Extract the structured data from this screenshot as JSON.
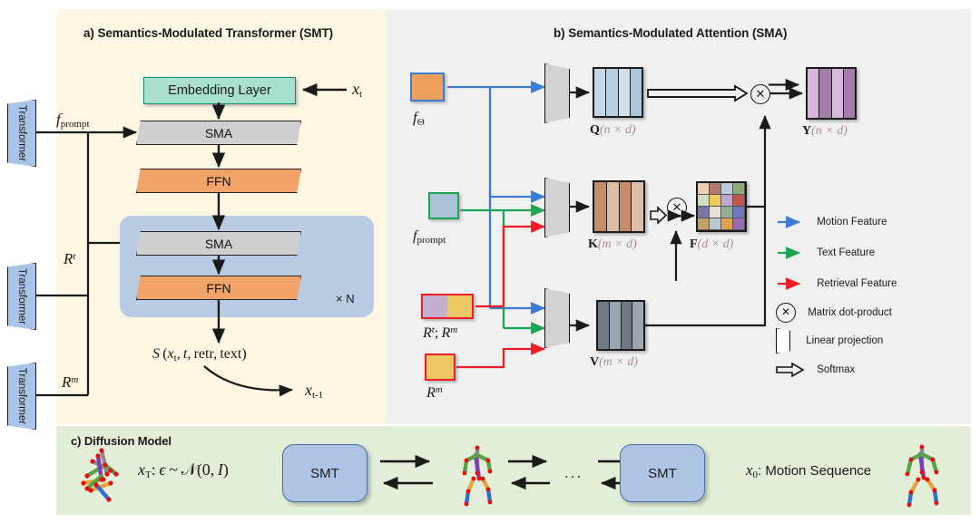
{
  "panels": {
    "a": {
      "title": "a) Semantics-Modulated Transformer (SMT)"
    },
    "b": {
      "title": "b) Semantics-Modulated Attention (SMA)"
    },
    "c": {
      "title": "c) Diffusion Model"
    }
  },
  "smt": {
    "embedding_label": "Embedding Layer",
    "input_token": "xₜ",
    "sma_label": "SMA",
    "ffn_label": "FFN",
    "repeat_label": "× N",
    "output_expr": "S(xₜ, t, retr, text)",
    "output_token": "xₜ₋₁",
    "transformers": [
      {
        "label": "Transformer",
        "output": "f_prompt"
      },
      {
        "label": "Transformer",
        "output": "R^t"
      },
      {
        "label": "Transformer",
        "output": "R^m"
      }
    ],
    "stream_labels": {
      "f_prompt": "f",
      "f_prompt_sub": "prompt",
      "r_t": "R",
      "r_t_sup": "t",
      "r_m": "R",
      "r_m_sup": "m"
    }
  },
  "sma": {
    "inputs": [
      {
        "name": "f_theta",
        "label_main": "f",
        "label_sub": "Θ",
        "color": "#f0a05a",
        "border": "#3a7bd5"
      },
      {
        "name": "f_prompt",
        "label_main": "f",
        "label_sub": "prompt",
        "color": "#a9c2d6",
        "border": "#19a551"
      },
      {
        "name": "r_t_r_m",
        "label_main": "R",
        "label_sup": "t",
        "label_sep": "; R",
        "label_sup2": "m",
        "color_left": "#c3aecd",
        "color_right": "#edc764",
        "border": "#ee1c24"
      },
      {
        "name": "r_m",
        "label_main": "R",
        "label_sup": "m",
        "color": "#edc764",
        "border": "#ee1c24"
      }
    ],
    "matrices": [
      {
        "key": "Q",
        "symbol": "Q",
        "dims": "(n × d)",
        "colors": [
          "#c4d8e6",
          "#b6cfe0",
          "#cfe0ea",
          "#a9c6da"
        ]
      },
      {
        "key": "K",
        "symbol": "K",
        "dims": "(m × d)",
        "colors": [
          "#c68d68",
          "#dcbda6",
          "#c68d68",
          "#dcbda6"
        ]
      },
      {
        "key": "V",
        "symbol": "V",
        "dims": "(m × d)",
        "colors": [
          "#6f7a85",
          "#9aa6b2",
          "#6f7a85",
          "#9aa6b2"
        ]
      },
      {
        "key": "Y",
        "symbol": "Y",
        "dims": "(n × d)",
        "colors": [
          "#d8b9dc",
          "#a57aad",
          "#d8b9dc",
          "#a57aad"
        ]
      },
      {
        "key": "F",
        "symbol": "F",
        "dims": "(d × d)",
        "grid": [
          "#eccdb3",
          "#b07a6e",
          "#b9ccdd",
          "#8fa878",
          "#d3ddc0",
          "#eccc58",
          "#c0a8cc",
          "#c1564f",
          "#7c76a8",
          "#e6e1d6",
          "#8fae92",
          "#6e79b8",
          "#c2a263",
          "#b9c8d2",
          "#e2a052",
          "#9a6bb5"
        ]
      }
    ],
    "dot_symbol": "⊗",
    "legend": [
      {
        "icon": "blue-arrow-icon",
        "label": "Motion Feature",
        "color": "#3a7bd5"
      },
      {
        "icon": "green-arrow-icon",
        "label": "Text Feature",
        "color": "#19a551"
      },
      {
        "icon": "red-arrow-icon",
        "label": "Retrieval Feature",
        "color": "#ee1c24"
      },
      {
        "icon": "circle-x-icon",
        "label": "Matrix dot-product",
        "color": "#111111"
      },
      {
        "icon": "linear-projection-icon",
        "label": "Linear projection",
        "color": "#111111"
      },
      {
        "icon": "softmax-arrow-icon",
        "label": "Softmax",
        "color": "#111111"
      }
    ]
  },
  "diffusion": {
    "noise_label": "x_T: ϵ ~ N(0, I)",
    "smt_label": "SMT",
    "ellipsis": "...",
    "output_label": "x_0: Motion Sequence"
  },
  "colors": {
    "panel_a_bg": "#fdf6e3",
    "panel_b_bg": "#f0f0f0",
    "panel_c_bg": "#e2eed8",
    "sma_block": "#cfcfcf",
    "ffn_block": "#f2a36a",
    "embedding_block": "#a8e0cd",
    "repeat_block": "#b9cbe3",
    "transformer_block": "#a9c4e8",
    "motion": "#3a7bd5",
    "text": "#19a551",
    "retrieval": "#ee1c24"
  }
}
